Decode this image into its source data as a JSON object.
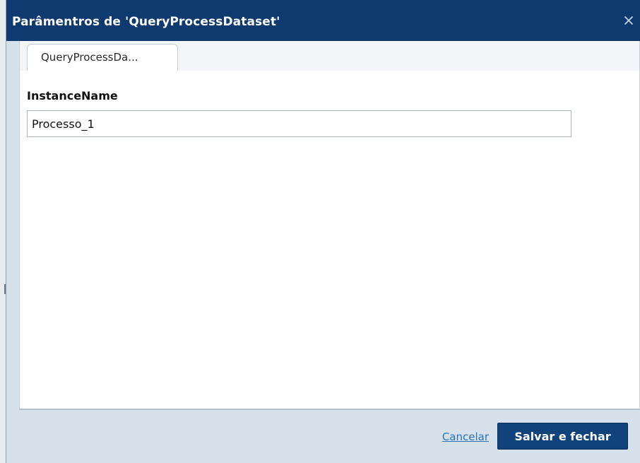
{
  "dialog": {
    "title": "Parâmentros de 'QueryProcessDataset'",
    "close_icon": "×"
  },
  "tabs": [
    {
      "label": "QueryProcessDa..."
    }
  ],
  "form": {
    "instance_name_label": "InstanceName",
    "instance_name_value": "Processo_1"
  },
  "footer": {
    "cancel_label": "Cancelar",
    "save_label": "Salvar e fechar"
  }
}
